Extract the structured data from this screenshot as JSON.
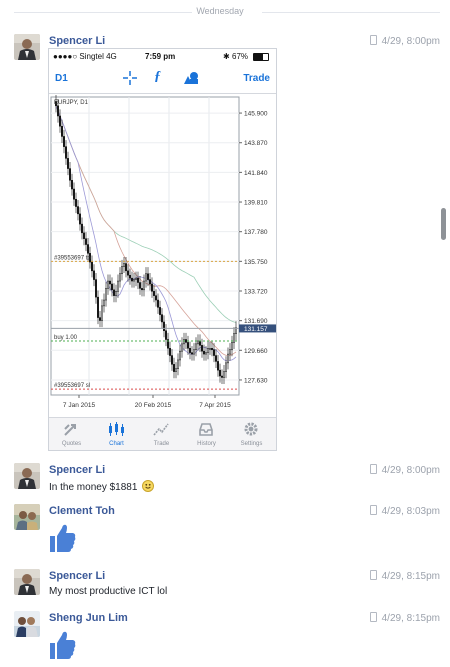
{
  "day_separator": "Wednesday",
  "messages": [
    {
      "sender": "Spencer Li",
      "time": "4/29, 8:00pm"
    },
    {
      "sender": "Spencer Li",
      "time": "4/29, 8:00pm",
      "text": "In the money $1881"
    },
    {
      "sender": "Clement Toh",
      "time": "4/29, 8:03pm"
    },
    {
      "sender": "Spencer Li",
      "time": "4/29, 8:15pm",
      "text": "My most productive ICT lol"
    },
    {
      "sender": "Sheng Jun Lim",
      "time": "4/29, 8:15pm"
    }
  ],
  "phone": {
    "carrier": "●●●●○ Singtel  4G",
    "clock": "7:59 pm",
    "battery": "67%",
    "timeframe": "D1",
    "trade_label": "Trade",
    "tabs": [
      "Quotes",
      "Chart",
      "Trade",
      "History",
      "Settings"
    ],
    "active_tab": "Chart"
  },
  "chart_data": {
    "type": "candlestick",
    "symbol": "EURJPY, D1",
    "y_ticks": [
      "145.900",
      "143.870",
      "141.840",
      "139.810",
      "137.780",
      "135.750",
      "133.720",
      "131.690",
      "129.660",
      "127.630"
    ],
    "current_price": "131.157",
    "x_ticks": [
      "7 Jan 2015",
      "20 Feb 2015",
      "7 Apr 2015"
    ],
    "annotations": {
      "take_profit": "#39553697 tp",
      "buy": "buy 1.00",
      "stop_loss": "#39553697 sl"
    },
    "ylim": [
      126.6,
      147.0
    ],
    "closes": [
      146.4,
      145.7,
      145.0,
      144.3,
      143.6,
      142.8,
      142.1,
      141.3,
      140.7,
      140.0,
      139.5,
      139.0,
      138.3,
      137.7,
      137.3,
      136.9,
      136.3,
      135.7,
      135.1,
      134.5,
      133.3,
      131.9,
      131.7,
      132.7,
      133.1,
      133.9,
      134.4,
      134.2,
      133.8,
      133.4,
      133.7,
      134.4,
      134.9,
      135.4,
      135.6,
      135.1,
      134.8,
      134.6,
      134.4,
      134.5,
      134.6,
      134.3,
      133.9,
      133.8,
      134.4,
      134.9,
      134.5,
      134.2,
      133.7,
      133.4,
      133.1,
      132.6,
      132.1,
      131.6,
      131.0,
      130.4,
      129.8,
      129.3,
      128.7,
      128.2,
      128.4,
      129.0,
      129.6,
      130.1,
      130.4,
      130.2,
      129.8,
      129.5,
      129.4,
      129.7,
      130.1,
      130.3,
      130.0,
      129.6,
      129.4,
      129.5,
      129.8,
      129.8,
      129.7,
      129.3,
      128.9,
      128.3,
      127.9,
      127.8,
      128.2,
      128.8,
      129.4,
      129.7,
      130.2,
      130.8,
      131.2
    ]
  }
}
